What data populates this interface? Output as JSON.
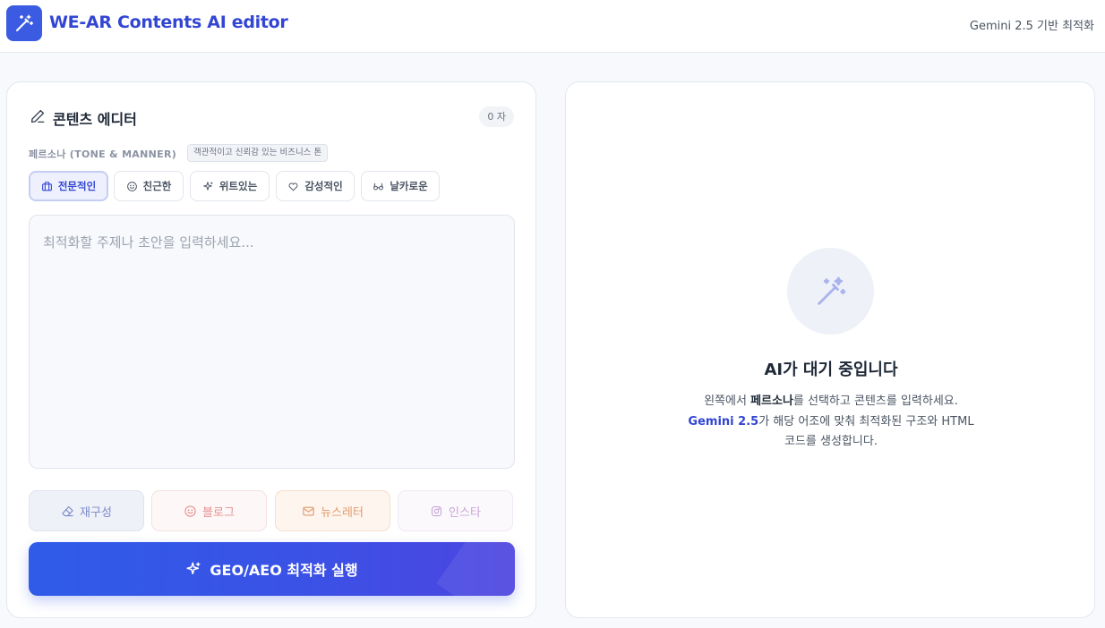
{
  "app": {
    "title": "WE-AR Contents AI editor",
    "subtitle_right": "Gemini 2.5 기반 최적화",
    "logo_icon": "magic-wand-icon",
    "accent_color": "#3346d3"
  },
  "editor": {
    "title": "콘텐츠 에디터",
    "char_count": "0 자",
    "persona_label": "페르소나 (TONE & MANNER)",
    "persona_hint": "객관적이고 신뢰감 있는 비즈니스 톤",
    "tones": [
      {
        "label": "전문적인",
        "icon": "briefcase-icon",
        "active": true
      },
      {
        "label": "친근한",
        "icon": "smile-icon",
        "active": false
      },
      {
        "label": "위트있는",
        "icon": "sparkle-icon",
        "active": false
      },
      {
        "label": "감성적인",
        "icon": "heart-icon",
        "active": false
      },
      {
        "label": "날카로운",
        "icon": "glasses-icon",
        "active": false
      }
    ],
    "input_placeholder": "최적화할 주제나 초안을 입력하세요...",
    "input_value": "",
    "formats": [
      {
        "label": "재구성",
        "icon": "eraser-icon"
      },
      {
        "label": "블로그",
        "icon": "smile-icon"
      },
      {
        "label": "뉴스레터",
        "icon": "mail-icon"
      },
      {
        "label": "인스타",
        "icon": "instagram-icon"
      }
    ],
    "run_label": "GEO/AEO 최적화 실행"
  },
  "preview": {
    "icon": "magic-wand-icon",
    "title": "AI가 대기 중입니다",
    "line1_prefix": "왼쪽에서 ",
    "line1_bold": "페르소나",
    "line1_suffix": "를 선택하고 콘텐츠를 입력하세요.",
    "line2_accent": "Gemini 2.5",
    "line2_suffix": "가 해당 어조에 맞춰 최적화된 구조와 HTML",
    "line3": "코드를 생성합니다."
  }
}
